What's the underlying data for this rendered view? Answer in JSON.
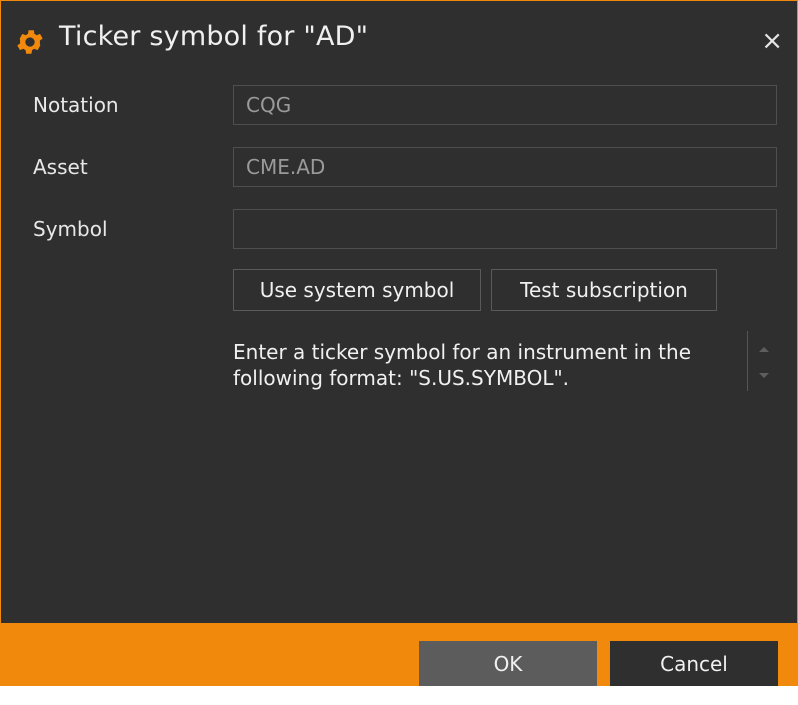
{
  "window": {
    "title": "Ticker symbol for \"AD\"",
    "close_glyph": "×",
    "icon": "gear-icon",
    "accent_color": "#f18a0c"
  },
  "form": {
    "notation": {
      "label": "Notation",
      "value": "CQG"
    },
    "asset": {
      "label": "Asset",
      "value": "CME.AD"
    },
    "symbol": {
      "label": "Symbol",
      "value": ""
    }
  },
  "actions": {
    "use_system_symbol": "Use system symbol",
    "test_subscription": "Test subscription"
  },
  "info": {
    "line1": "Enter a ticker symbol for an instrument in the",
    "line2": "following format: \"S.US.SYMBOL\"."
  },
  "footer": {
    "ok": "OK",
    "cancel": "Cancel"
  }
}
